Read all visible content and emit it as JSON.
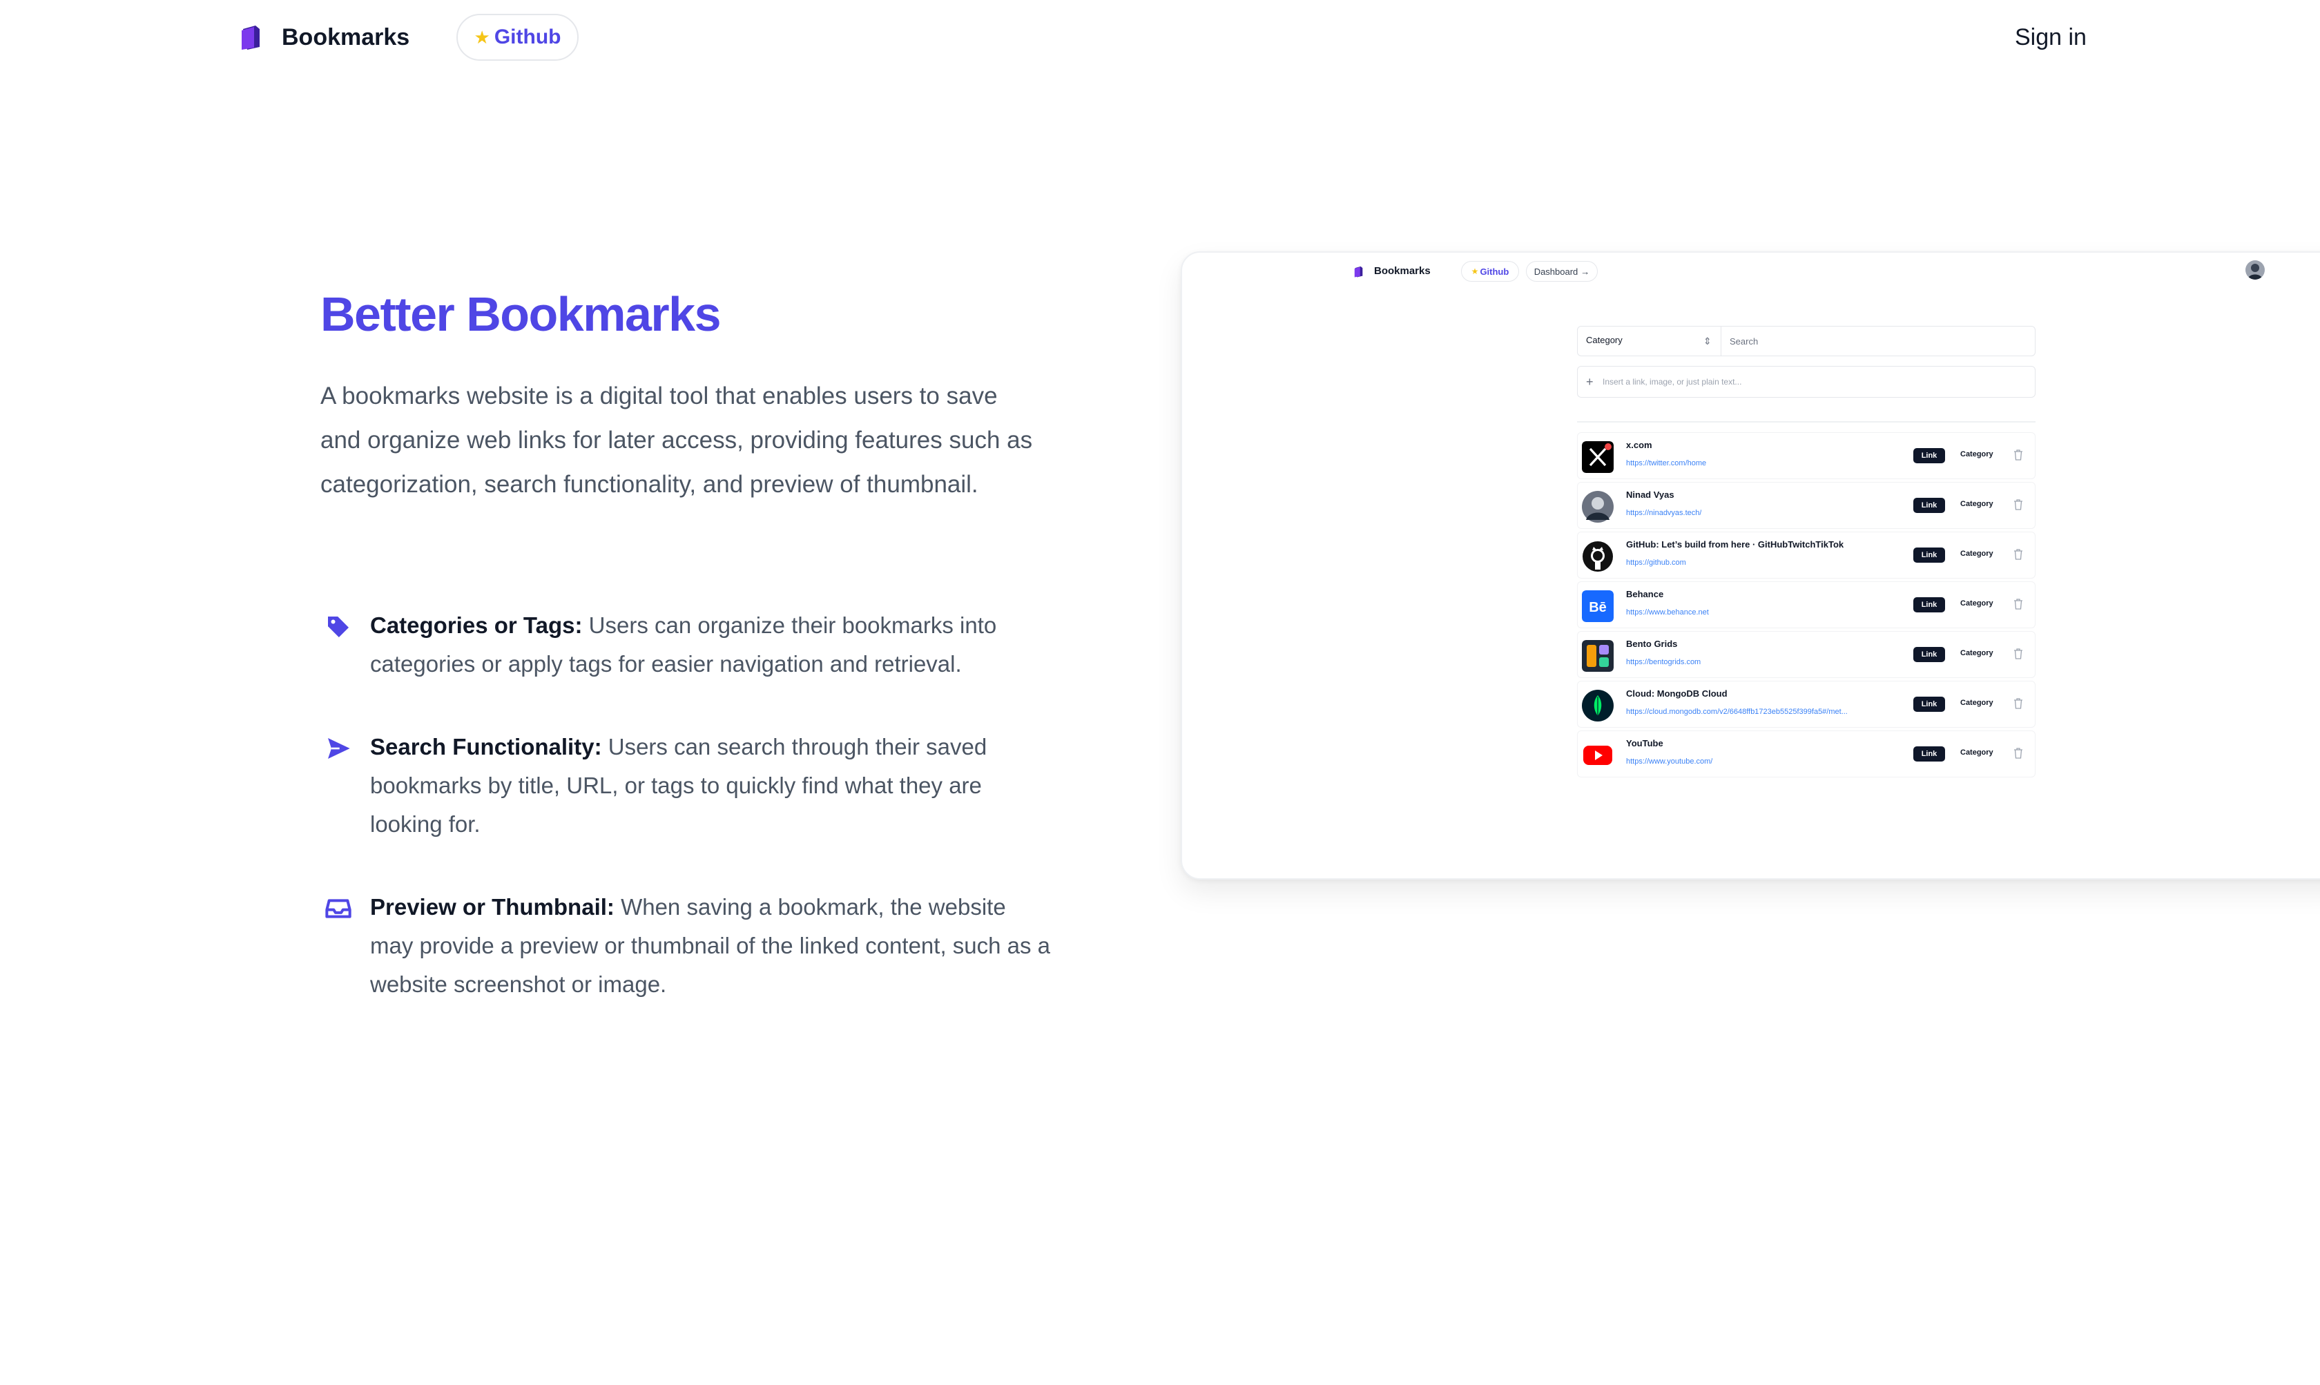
{
  "nav": {
    "brand": "Bookmarks",
    "github_label": "Github",
    "signin_label": "Sign in"
  },
  "hero": {
    "title": "Better Bookmarks",
    "description": "A bookmarks website is a digital tool that enables users to save and organize web links for later access, providing features such as categorization, search functionality, and preview of thumbnail.",
    "features": [
      {
        "icon": "tag-icon",
        "title": "Categories or Tags:",
        "text": "Users can organize their bookmarks into categories or apply tags for easier navigation and retrieval."
      },
      {
        "icon": "send-icon",
        "title": "Search Functionality:",
        "text": "Users can search through their saved bookmarks by title, URL, or tags to quickly find what they are looking for."
      },
      {
        "icon": "inbox-icon",
        "title": "Preview or Thumbnail:",
        "text": "When saving a bookmark, the website may provide a preview or thumbnail of the linked content, such as a website screenshot or image."
      }
    ]
  },
  "preview": {
    "brand": "Bookmarks",
    "github_label": "Github",
    "dashboard_label": "Dashboard",
    "category_label": "Category",
    "search_placeholder": "Search",
    "insert_placeholder": "Insert a link, image, or just plain text...",
    "bookmarks": [
      {
        "title": "x.com",
        "url": "https://twitter.com/home",
        "type": "Link",
        "category": "Category",
        "icon": "x-logo-icon"
      },
      {
        "title": "Ninad Vyas",
        "url": "https://ninadvyas.tech/",
        "type": "Link",
        "category": "Category",
        "icon": "profile-photo-icon"
      },
      {
        "title": "GitHub: Let’s build from here · GitHubTwitchTikTok",
        "url": "https://github.com",
        "type": "Link",
        "category": "Category",
        "icon": "github-logo-icon"
      },
      {
        "title": "Behance",
        "url": "https://www.behance.net",
        "type": "Link",
        "category": "Category",
        "icon": "behance-logo-icon"
      },
      {
        "title": "Bento Grids",
        "url": "https://bentogrids.com",
        "type": "Link",
        "category": "Category",
        "icon": "bento-grids-logo-icon"
      },
      {
        "title": "Cloud: MongoDB Cloud",
        "url": "https://cloud.mongodb.com/v2/6648ffb1723eb5525f399fa5#/met...",
        "type": "Link",
        "category": "Category",
        "icon": "mongodb-logo-icon"
      },
      {
        "title": "YouTube",
        "url": "https://www.youtube.com/",
        "type": "Link",
        "category": "Category",
        "icon": "youtube-logo-icon"
      }
    ]
  },
  "colors": {
    "accent": "#4f46e5",
    "link": "#3b82f6",
    "tag_bg": "#0f172a"
  }
}
